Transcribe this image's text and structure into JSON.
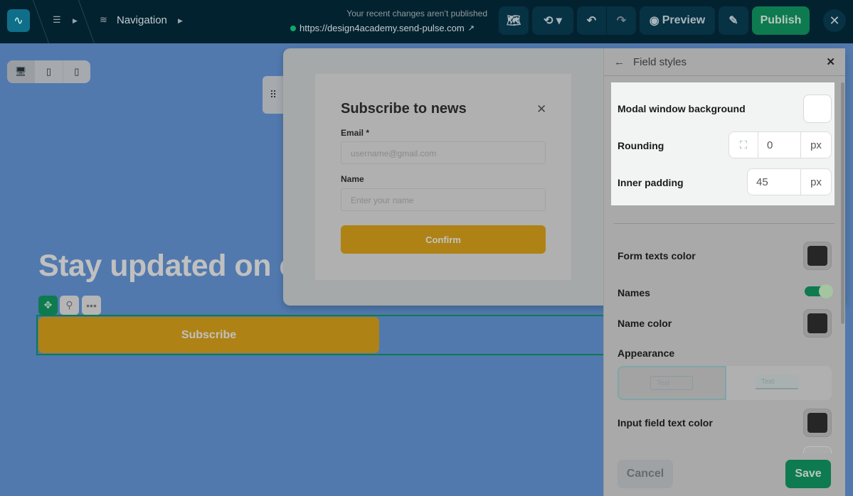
{
  "topbar": {
    "logo": "pulse-logo",
    "breadcrumb": {
      "nav_label": "Navigation"
    },
    "status_text": "Your recent changes aren’t published",
    "site_url": "https://design4academy.send-pulse.com",
    "preview_label": "Preview",
    "publish_label": "Publish"
  },
  "canvas": {
    "headline": "Stay updated on c",
    "subscribe_label": "Subscribe"
  },
  "modal_form": {
    "title": "Subscribe to news",
    "email_label": "Email *",
    "email_placeholder": "username@gmail.com",
    "name_label": "Name",
    "name_placeholder": "Enter your name",
    "confirm_label": "Confirm"
  },
  "panel": {
    "title": "Field styles",
    "modal_bg_label": "Modal window background",
    "modal_bg_color": "#ffffff",
    "rounding_label": "Rounding",
    "rounding_value": "0",
    "rounding_unit": "px",
    "padding_label": "Inner padding",
    "padding_value": "45",
    "padding_unit": "px",
    "form_text_color_label": "Form texts color",
    "names_label": "Names",
    "names_enabled": true,
    "name_color_label": "Name color",
    "appearance_label": "Appearance",
    "appearance_options": [
      "Text",
      "Text"
    ],
    "input_text_color_label": "Input field text color",
    "cancel_label": "Cancel",
    "save_label": "Save"
  },
  "colors": {
    "accent": "#0e7a4f",
    "button": "#ae8215",
    "topbar": "#03222f"
  }
}
